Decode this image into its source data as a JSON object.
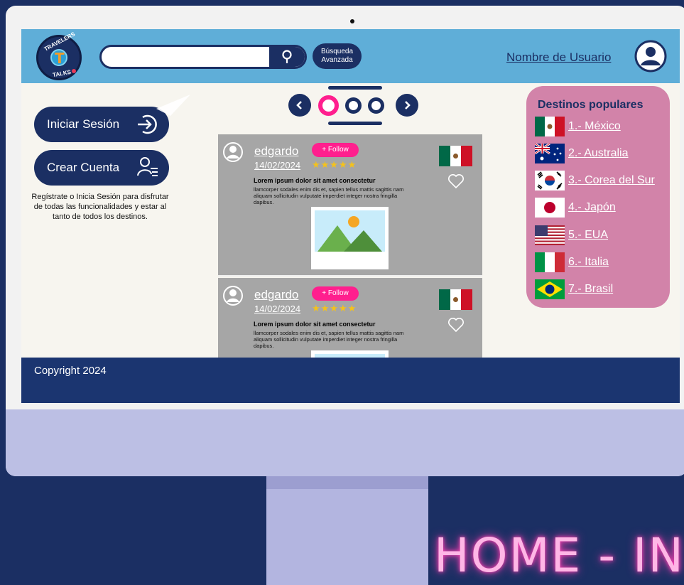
{
  "header": {
    "logo_text_top": "TRAVELERS",
    "logo_text_bottom": "TALKS",
    "search_placeholder": "",
    "advanced_search_line1": "Búsqueda",
    "advanced_search_line2": "Avanzada",
    "username": "Nombre de Usuario"
  },
  "left": {
    "login_label": "Iniciar Sesión",
    "create_label": "Crear Cuenta",
    "info_text": "Regístrate o Inicia Sesión para disfrutar de todas las funcionalidades y estar al tanto de todos los destinos."
  },
  "posts": [
    {
      "username": "edgardo",
      "follow_label": "+ Follow",
      "date": "14/02/2024",
      "rating": 4.5,
      "stars": "★★★★★",
      "title": "Lorem ipsum dolor sit amet consectetur",
      "body": "llamcorper sodales enim dis et, sapien tellus mattis sagittis nam aliquam sollicitudin vulputate imperdiet integer nostra fringilla dapibus."
    },
    {
      "username": "edgardo",
      "follow_label": "+ Follow",
      "date": "14/02/2024",
      "rating": 4.5,
      "stars": "★★★★★",
      "title": "Lorem ipsum dolor sit amet consectetur",
      "body": "llamcorper sodales enim dis et, sapien tellus mattis sagittis nam aliquam sollicitudin vulputate imperdiet integer nostra fringilla dapibus."
    }
  ],
  "destinos": {
    "title": "Destinos populares",
    "items": [
      {
        "label": "1.- México",
        "flag": "mexico-flag"
      },
      {
        "label": "2.- Australia",
        "flag": "australia-flag"
      },
      {
        "label": "3.- Corea del Sur",
        "flag": "south-korea-flag"
      },
      {
        "label": "4.- Japón",
        "flag": "japan-flag"
      },
      {
        "label": "5.- EUA",
        "flag": "usa-flag"
      },
      {
        "label": "6.- Italia",
        "flag": "italy-flag"
      },
      {
        "label": "7.- Brasil",
        "flag": "brazil-flag"
      }
    ]
  },
  "footer": {
    "copyright": "Copyright 2024"
  },
  "neon_sign": "HOME - IN",
  "colors": {
    "navy": "#1b2f63",
    "header_blue": "#5faed8",
    "pink_panel": "#d283a9",
    "follow_pink": "#ff1f8e",
    "star_yellow": "#f4c21b",
    "post_gray": "#a6a6a6"
  }
}
